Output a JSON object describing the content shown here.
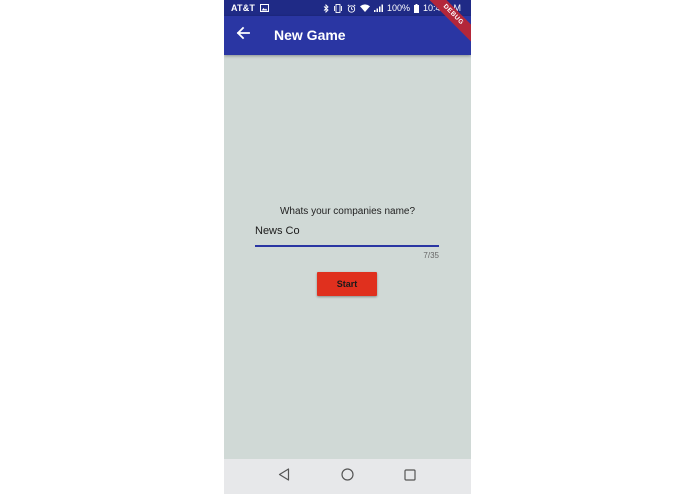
{
  "status_bar": {
    "carrier": "AT&T",
    "battery_percent": "100%",
    "time": "10:49 AM",
    "icons": [
      "image-icon",
      "bluetooth-icon",
      "vibrate-icon",
      "alarm-icon",
      "wifi-icon",
      "signal-icon",
      "battery-icon"
    ]
  },
  "app_bar": {
    "title": "New Game",
    "back_icon": "arrow-back-icon",
    "color": "#2a36a3"
  },
  "debug_banner": "DEBUG",
  "form": {
    "prompt": "Whats your companies name?",
    "name_value": "News Co",
    "counter": "7/35",
    "accent_color": "#2a36a3"
  },
  "start_button": {
    "label": "Start",
    "color": "#e0301e"
  },
  "nav_bar": {
    "icons": [
      "back-triangle-icon",
      "home-circle-icon",
      "recents-square-icon"
    ]
  },
  "colors": {
    "background": "#d0d9d6",
    "status_bar": "#1f2a86"
  }
}
